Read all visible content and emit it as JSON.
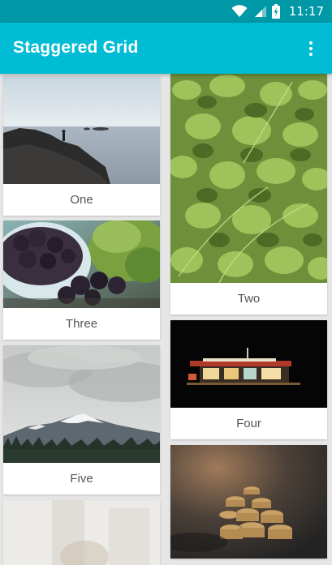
{
  "status_bar": {
    "time": "11:17",
    "icons": [
      "wifi-icon",
      "signal-icon",
      "battery-charging-icon"
    ]
  },
  "app_bar": {
    "title": "Staggered Grid",
    "menu_icon": "overflow-menu-icon"
  },
  "colors": {
    "status_bar": "#0097a7",
    "app_bar": "#00bcd4",
    "background": "#e6e6e6",
    "card": "#ffffff",
    "label_text": "#555555"
  },
  "cards": [
    {
      "label": "One",
      "image": "rocky coast with person on rocks"
    },
    {
      "label": "Two",
      "image": "cilantro leaves close-up"
    },
    {
      "label": "Three",
      "image": "blackberries in a bowl"
    },
    {
      "label": "Four",
      "image": "gas station at night"
    },
    {
      "label": "Five",
      "image": "snowy mountain under cloudy sky"
    },
    {
      "label": "",
      "image": "blurred bright interior"
    },
    {
      "label": "",
      "image": "stacked coins"
    }
  ]
}
